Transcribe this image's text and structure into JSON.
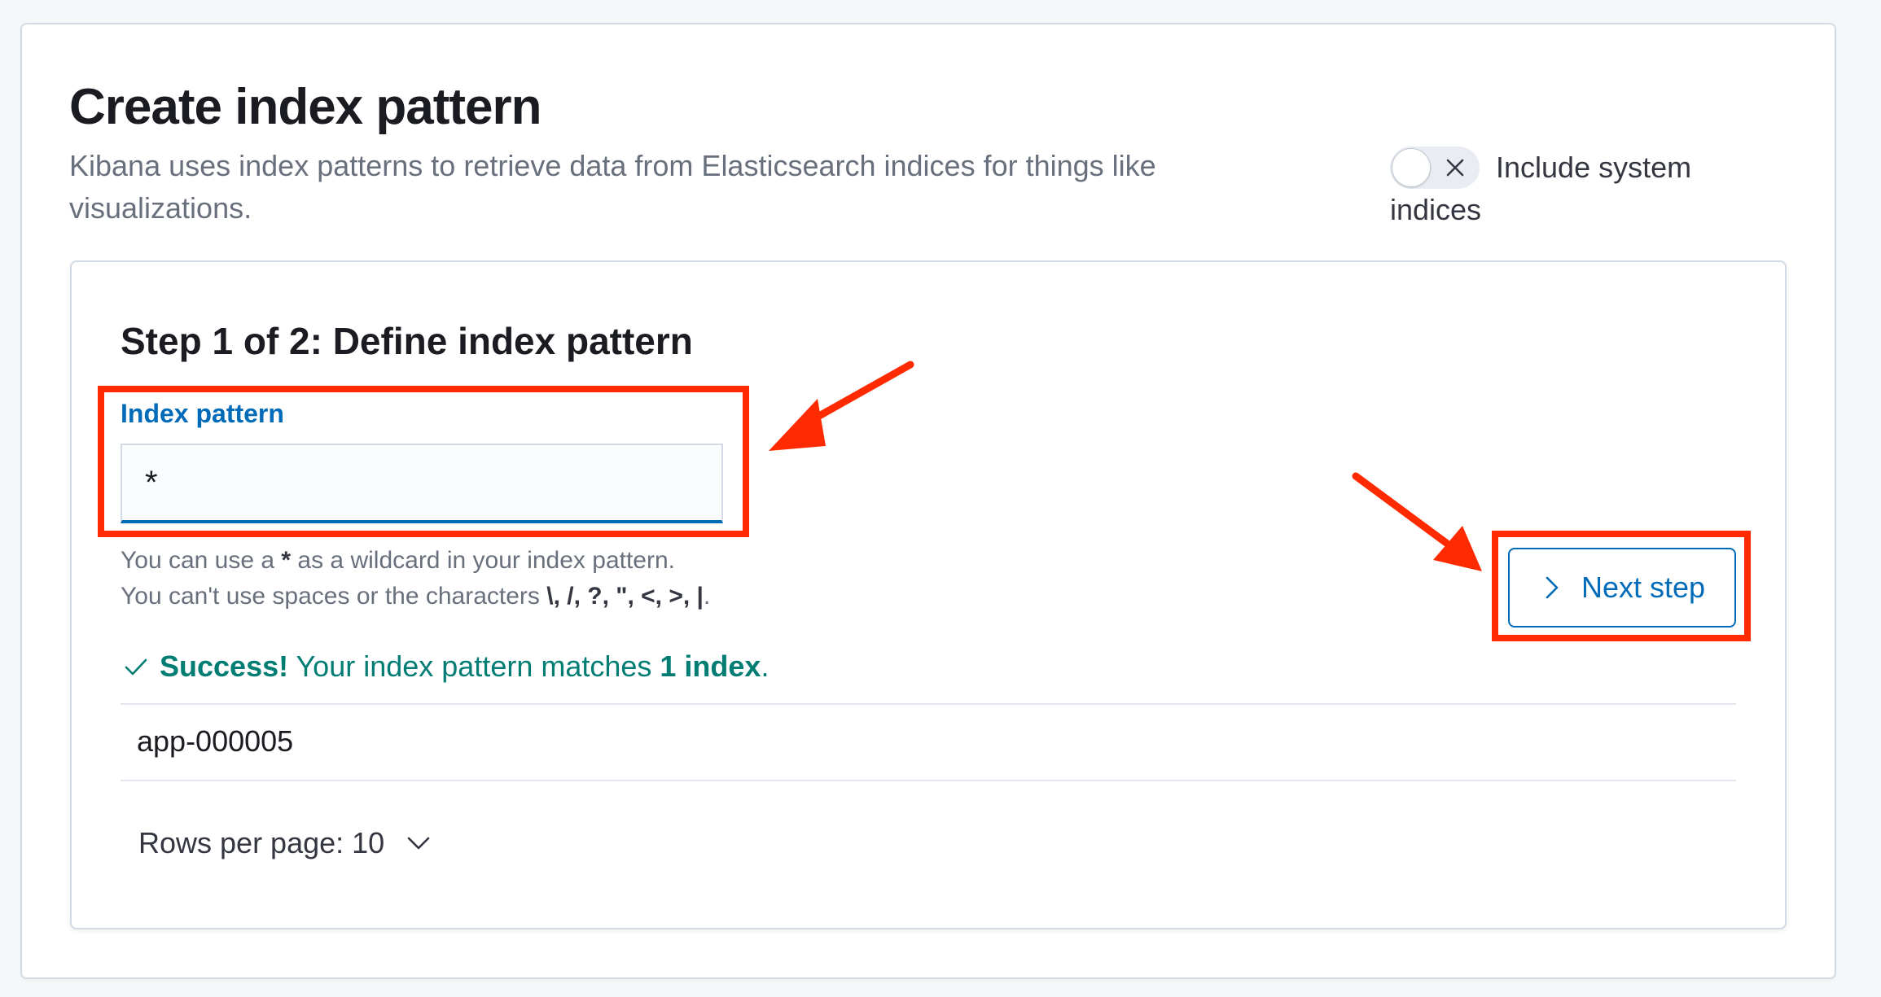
{
  "page": {
    "title": "Create index pattern",
    "description": "Kibana uses index patterns to retrieve data from Elasticsearch indices for things like visualizations.",
    "system_toggle": {
      "label": "Include system indices",
      "checked": false,
      "off_icon": "close-icon"
    }
  },
  "step": {
    "title": "Step 1 of 2: Define index pattern",
    "field_label": "Index pattern",
    "input_value": "*",
    "help_line1_pre": "You can use a ",
    "help_line1_bold": "*",
    "help_line1_post": " as a wildcard in your index pattern.",
    "help_line2_pre": "You can't use spaces or the characters ",
    "help_line2_bold": "\\, /, ?, \", <, >, |",
    "help_line2_post": ".",
    "success_bold": "Success!",
    "success_mid": " Your index pattern matches ",
    "success_count": "1 index",
    "success_end": ".",
    "next_button": "Next step"
  },
  "table": {
    "rows": [
      "app-000005"
    ],
    "rows_per_page_label": "Rows per page: 10"
  },
  "colors": {
    "accent": "#006bb8",
    "success": "#017d73",
    "annotation": "#ff2a00"
  }
}
